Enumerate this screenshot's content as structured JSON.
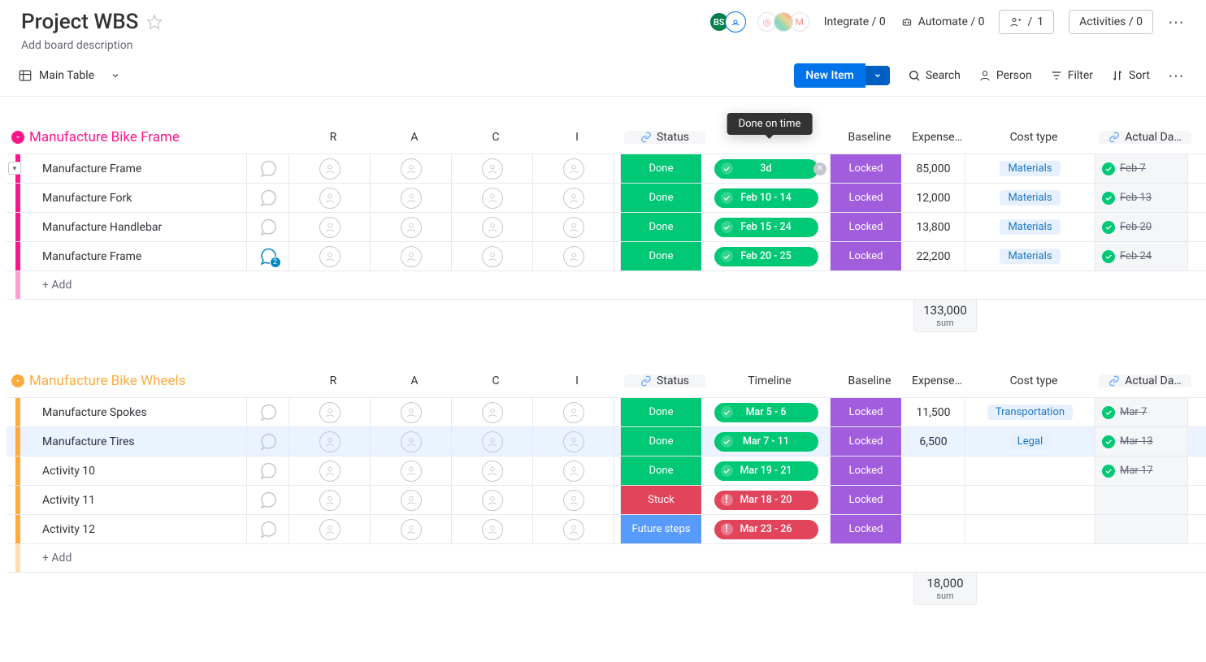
{
  "header": {
    "title": "Project WBS",
    "description_placeholder": "Add board description",
    "integrate": "Integrate / 0",
    "automate": "Automate / 0",
    "invite_count": "1",
    "activities": "Activities / 0"
  },
  "toolbar": {
    "view_name": "Main Table",
    "new_item": "New Item",
    "search": "Search",
    "person": "Person",
    "filter": "Filter",
    "sort": "Sort"
  },
  "tooltip": {
    "text": "Done on time"
  },
  "columns": {
    "r": "R",
    "a": "A",
    "c": "C",
    "i": "I",
    "status": "Status",
    "timeline": "Timeline",
    "baseline": "Baseline",
    "expense": "Expense…",
    "cost_type": "Cost type",
    "actual": "Actual Da…"
  },
  "add_label": "+ Add",
  "sum_label": "sum",
  "groups": [
    {
      "name": "Manufacture Bike Frame",
      "color": "#ff158a",
      "timeline_header_hidden": true,
      "items": [
        {
          "name": "Manufacture Frame",
          "chat_count": 0,
          "status": "Done",
          "status_color": "#00c875",
          "timeline": "3d",
          "timeline_type": "done",
          "timeline_has_x": true,
          "baseline": "Locked",
          "expense": "85,000",
          "cost_type": "Materials",
          "actual_date": "Feb 7",
          "show_expand": true
        },
        {
          "name": "Manufacture Fork",
          "chat_count": 0,
          "status": "Done",
          "status_color": "#00c875",
          "timeline": "Feb 10 - 14",
          "timeline_type": "done",
          "baseline": "Locked",
          "expense": "12,000",
          "cost_type": "Materials",
          "actual_date": "Feb 13"
        },
        {
          "name": "Manufacture Handlebar",
          "chat_count": 0,
          "status": "Done",
          "status_color": "#00c875",
          "timeline": "Feb 15 - 24",
          "timeline_type": "done",
          "baseline": "Locked",
          "expense": "13,800",
          "cost_type": "Materials",
          "actual_date": "Feb 20"
        },
        {
          "name": "Manufacture Frame",
          "chat_count": 2,
          "status": "Done",
          "status_color": "#00c875",
          "timeline": "Feb 20 - 25",
          "timeline_type": "done",
          "baseline": "Locked",
          "expense": "22,200",
          "cost_type": "Materials",
          "actual_date": "Feb 24"
        }
      ],
      "sum": "133,000"
    },
    {
      "name": "Manufacture Bike Wheels",
      "color": "#fdab3d",
      "items": [
        {
          "name": "Manufacture Spokes",
          "chat_count": 0,
          "status": "Done",
          "status_color": "#00c875",
          "timeline": "Mar 5 - 6",
          "timeline_type": "done",
          "baseline": "Locked",
          "expense": "11,500",
          "cost_type": "Transportation",
          "actual_date": "Mar 7"
        },
        {
          "name": "Manufacture Tires",
          "chat_count": 0,
          "highlight": true,
          "status": "Done",
          "status_color": "#00c875",
          "timeline": "Mar 7 - 11",
          "timeline_type": "done",
          "baseline": "Locked",
          "expense": "6,500",
          "cost_type": "Legal",
          "actual_date": "Mar 13"
        },
        {
          "name": "Activity 10",
          "chat_count": 0,
          "status": "Done",
          "status_color": "#00c875",
          "timeline": "Mar 19 - 21",
          "timeline_type": "done",
          "baseline": "Locked",
          "expense": "",
          "cost_type": "",
          "actual_date": "Mar 17"
        },
        {
          "name": "Activity 11",
          "chat_count": 0,
          "status": "Stuck",
          "status_color": "#e2445c",
          "timeline": "Mar 18 - 20",
          "timeline_type": "overdue",
          "baseline": "Locked",
          "expense": "",
          "cost_type": "",
          "actual_date": ""
        },
        {
          "name": "Activity 12",
          "chat_count": 0,
          "status": "Future steps",
          "status_color": "#579bfc",
          "timeline": "Mar 23 - 26",
          "timeline_type": "overdue",
          "baseline": "Locked",
          "expense": "",
          "cost_type": "",
          "actual_date": ""
        }
      ],
      "sum": "18,000"
    }
  ]
}
